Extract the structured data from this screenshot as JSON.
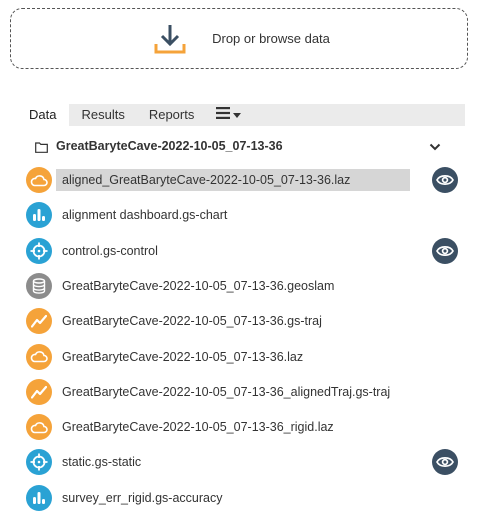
{
  "dropzone": {
    "label": "Drop or browse data"
  },
  "tabs": [
    {
      "label": "Data",
      "active": true
    },
    {
      "label": "Results",
      "active": false
    },
    {
      "label": "Reports",
      "active": false
    }
  ],
  "folder": {
    "name": "GreatBaryteCave-2022-10-05_07-13-36"
  },
  "files": [
    {
      "name": "aligned_GreatBaryteCave-2022-10-05_07-13-36.laz",
      "icon": "cloud-icon",
      "selected": true,
      "visible_toggle": true
    },
    {
      "name": "alignment dashboard.gs-chart",
      "icon": "chart-icon",
      "selected": false,
      "visible_toggle": false
    },
    {
      "name": "control.gs-control",
      "icon": "crosshair-icon",
      "selected": false,
      "visible_toggle": true
    },
    {
      "name": "GreatBaryteCave-2022-10-05_07-13-36.geoslam",
      "icon": "database-icon",
      "selected": false,
      "visible_toggle": false
    },
    {
      "name": "GreatBaryteCave-2022-10-05_07-13-36.gs-traj",
      "icon": "trajectory-icon",
      "selected": false,
      "visible_toggle": false
    },
    {
      "name": "GreatBaryteCave-2022-10-05_07-13-36.laz",
      "icon": "cloud-icon",
      "selected": false,
      "visible_toggle": false
    },
    {
      "name": "GreatBaryteCave-2022-10-05_07-13-36_alignedTraj.gs-traj",
      "icon": "trajectory-icon",
      "selected": false,
      "visible_toggle": false
    },
    {
      "name": "GreatBaryteCave-2022-10-05_07-13-36_rigid.laz",
      "icon": "cloud-icon",
      "selected": false,
      "visible_toggle": false
    },
    {
      "name": "static.gs-static",
      "icon": "crosshair-icon",
      "selected": false,
      "visible_toggle": true
    },
    {
      "name": "survey_err_rigid.gs-accuracy",
      "icon": "chart-icon",
      "selected": false,
      "visible_toggle": false
    }
  ],
  "colors": {
    "accent_orange": "#f5a33a",
    "accent_blue": "#2aa2d4",
    "database_gray": "#8c8c8c",
    "eye_button": "#3b4f63"
  }
}
